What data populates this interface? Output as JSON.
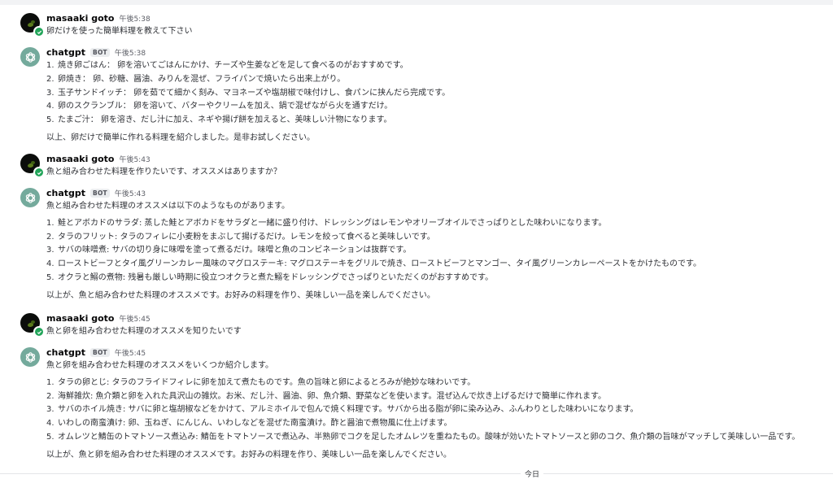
{
  "messages": [
    {
      "author": "masaaki goto",
      "is_bot": false,
      "time": "午後5:38",
      "text": "卵だけを使った簡単料理を教えて下さい"
    },
    {
      "author": "chatgpt",
      "is_bot": true,
      "badge": "BOT",
      "time": "午後5:38",
      "intro": "",
      "items": [
        "焼き卵ごはん： 卵を溶いてごはんにかけ、チーズや生姜などを足して食べるのがおすすめです。",
        "卵焼き： 卵、砂糖、醤油、みりんを混ぜ、フライパンで焼いたら出来上がり。",
        "玉子サンドイッチ： 卵を茹でて細かく刻み、マヨネーズや塩胡椒で味付けし、食パンに挟んだら完成です。",
        "卵のスクランブル： 卵を溶いて、バターやクリームを加え、鍋で混ぜながら火を通すだけ。",
        "たまご汁： 卵を溶き、だし汁に加え、ネギや揚げ餅を加えると、美味しい汁物になります。"
      ],
      "closing": "以上、卵だけで簡単に作れる料理を紹介しました。是非お試しください。"
    },
    {
      "author": "masaaki goto",
      "is_bot": false,
      "time": "午後5:43",
      "text": "魚と組み合わせた料理を作りたいです、オススメはありますか？"
    },
    {
      "author": "chatgpt",
      "is_bot": true,
      "badge": "BOT",
      "time": "午後5:43",
      "intro": "魚と組み合わせた料理のオススメは以下のようなものがあります。",
      "items": [
        "鮭とアボカドのサラダ: 蒸した鮭とアボカドをサラダと一緒に盛り付け、ドレッシングはレモンやオリーブオイルでさっぱりとした味わいになります。",
        "タラのフリット: タラのフィレに小麦粉をまぶして揚げるだけ。レモンを絞って食べると美味しいです。",
        "サバの味噌煮: サバの切り身に味噌を塗って煮るだけ。味噌と魚のコンビネーションは抜群です。",
        "ローストビーフとタイ風グリーンカレー風味のマグロステーキ: マグロステーキをグリルで焼き、ローストビーフとマンゴー、タイ風グリーンカレーペーストをかけたものです。",
        "オクラと鰯の煮物: 残暑も厳しい時期に役立つオクラと煮た鰯をドレッシングでさっぱりといただくのがおすすめです。"
      ],
      "closing": "以上が、魚と組み合わせた料理のオススメです。お好みの料理を作り、美味しい一品を楽しんでください。"
    },
    {
      "author": "masaaki goto",
      "is_bot": false,
      "time": "午後5:45",
      "text": "魚と卵を組み合わせた料理のオススメを知りたいです"
    },
    {
      "author": "chatgpt",
      "is_bot": true,
      "badge": "BOT",
      "time": "午後5:45",
      "intro": "魚と卵を組み合わせた料理のオススメをいくつか紹介します。",
      "items": [
        "タラの卵とじ: タラのフライドフィレに卵を加えて煮たものです。魚の旨味と卵によるとろみが絶妙な味わいです。",
        "海鮮雑炊: 魚介類と卵を入れた具沢山の雑炊。お米、だし汁、醤油、卵、魚介類、野菜などを使います。混ぜ込んで炊き上げるだけで簡単に作れます。",
        "サバのホイル焼き: サバに卵と塩胡椒などをかけて、アルミホイルで包んで焼く料理です。サバから出る脂が卵に染み込み、ふんわりとした味わいになります。",
        "いわしの南蛮漬け: 卵、玉ねぎ、にんじん、いわしなどを混ぜた南蛮漬け。酢と醤油で煮物風に仕上げます。",
        "オムレツと鯖缶のトマトソース煮込み: 鯖缶をトマトソースで煮込み、半熟卵でコクを足したオムレツを重ねたもの。酸味が効いたトマトソースと卵のコク、魚介類の旨味がマッチして美味しい一品です。"
      ],
      "closing": "以上が、魚と卵を組み合わせた料理のオススメです。お好みの料理を作り、美味しい一品を楽しんでください。"
    }
  ],
  "date_divider": "今日",
  "icons": {
    "user_avatar": "user-avatar",
    "bot_avatar": "openai-logo-icon",
    "verified": "check-badge-icon"
  }
}
